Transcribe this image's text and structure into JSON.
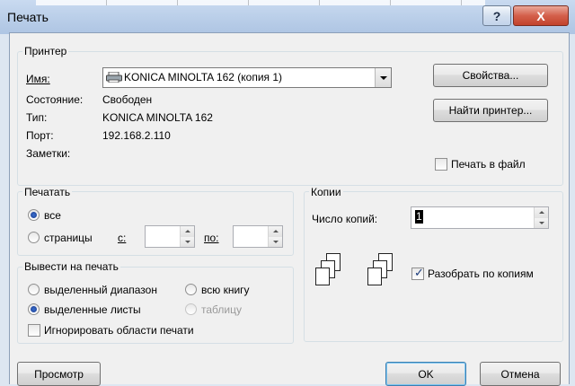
{
  "window": {
    "title": "Печать",
    "controls": {
      "help": "?",
      "close": "X"
    }
  },
  "printer": {
    "group_title": "Принтер",
    "name_label": "Имя:",
    "name_value": "KONICA MINOLTA 162 (копия 1)",
    "status_label": "Состояние:",
    "status_value": "Свободен",
    "type_label": "Тип:",
    "type_value": "KONICA MINOLTA 162",
    "port_label": "Порт:",
    "port_value": "192.168.2.110",
    "notes_label": "Заметки:",
    "properties_button": "Свойства...",
    "find_printer_button": "Найти принтер...",
    "print_to_file_label": "Печать в файл",
    "print_to_file_checked": false
  },
  "range": {
    "group_title": "Печатать",
    "all_label": "все",
    "pages_label": "страницы",
    "from_label": "с:",
    "to_label": "по:",
    "selected": "all"
  },
  "print_what": {
    "group_title": "Вывести на печать",
    "selection_label": "выделенный диапазон",
    "entire_workbook_label": "всю книгу",
    "active_sheets_label": "выделенные листы",
    "table_label": "таблицу",
    "ignore_areas_label": "Игнорировать области печати",
    "selected": "active_sheets",
    "ignore_areas_checked": false
  },
  "copies": {
    "group_title": "Копии",
    "number_label": "Число копий:",
    "number_value": "1",
    "collate_label": "Разобрать по копиям",
    "collate_checked": true
  },
  "footer": {
    "preview_button": "Просмотр",
    "ok_button": "OK",
    "cancel_button": "Отмена"
  },
  "colors": {
    "accent": "#3c7fb1",
    "close": "#c2422b"
  }
}
